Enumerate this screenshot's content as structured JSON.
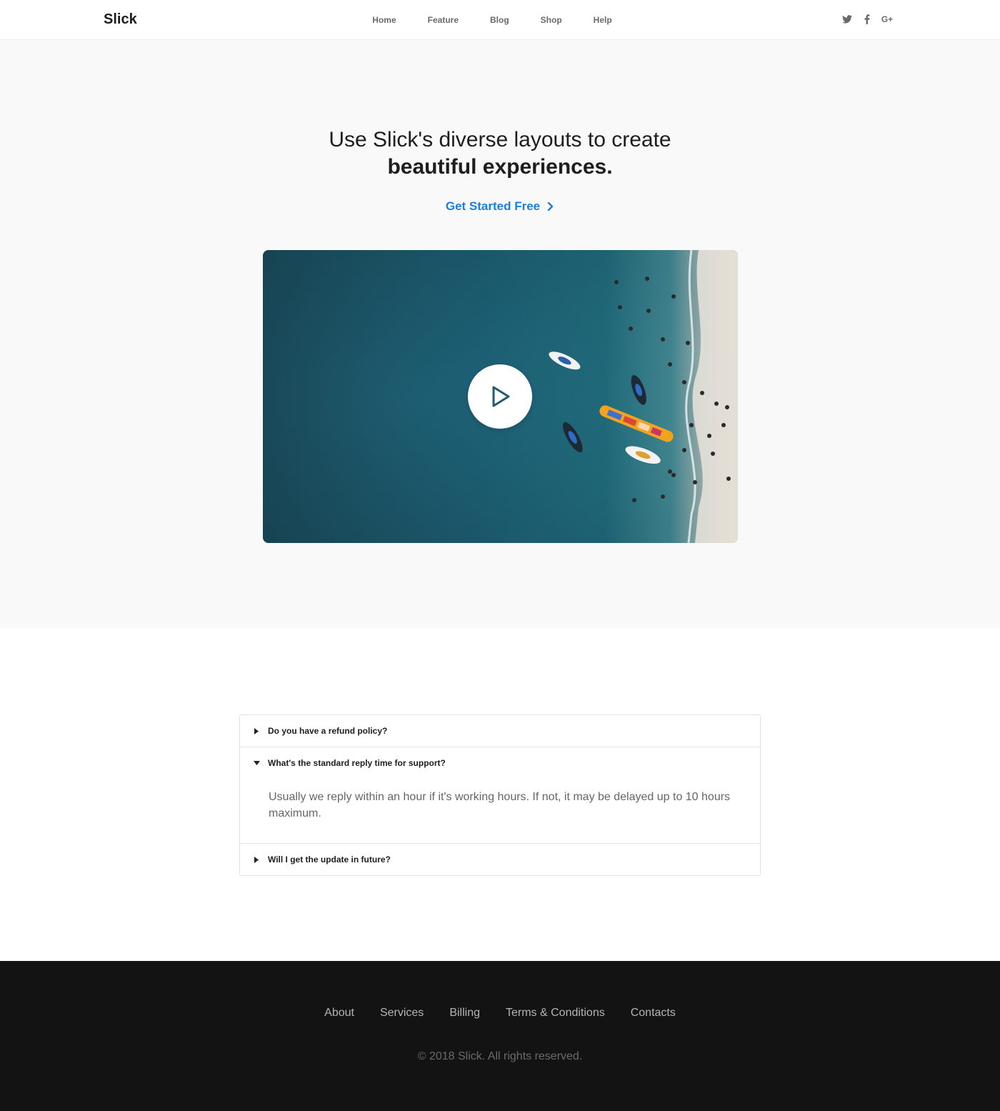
{
  "brand": "Slick",
  "nav": {
    "items": [
      {
        "label": "Home"
      },
      {
        "label": "Feature"
      },
      {
        "label": "Blog"
      },
      {
        "label": "Shop"
      },
      {
        "label": "Help"
      }
    ],
    "social": [
      "twitter-icon",
      "facebook-icon",
      "google-plus-icon"
    ],
    "google_plus_label": "G+"
  },
  "hero": {
    "title_line1": "Use Slick's diverse layouts to create",
    "title_line2": "beautiful experiences.",
    "cta_label": "Get Started Free",
    "accent_color": "#1a7fe0"
  },
  "faq": {
    "items": [
      {
        "question": "Do you have a refund policy?",
        "expanded": false
      },
      {
        "question": "What's the standard reply time for support?",
        "expanded": true,
        "answer": "Usually we reply within an hour if it's working hours. If not, it may be delayed up to 10 hours maximum."
      },
      {
        "question": "Will I get the update in future?",
        "expanded": false
      }
    ]
  },
  "footer": {
    "links": [
      {
        "label": "About"
      },
      {
        "label": "Services"
      },
      {
        "label": "Billing"
      },
      {
        "label": "Terms & Conditions"
      },
      {
        "label": "Contacts"
      }
    ],
    "copyright": "© 2018 Slick. All rights reserved.",
    "background": "#131313"
  }
}
